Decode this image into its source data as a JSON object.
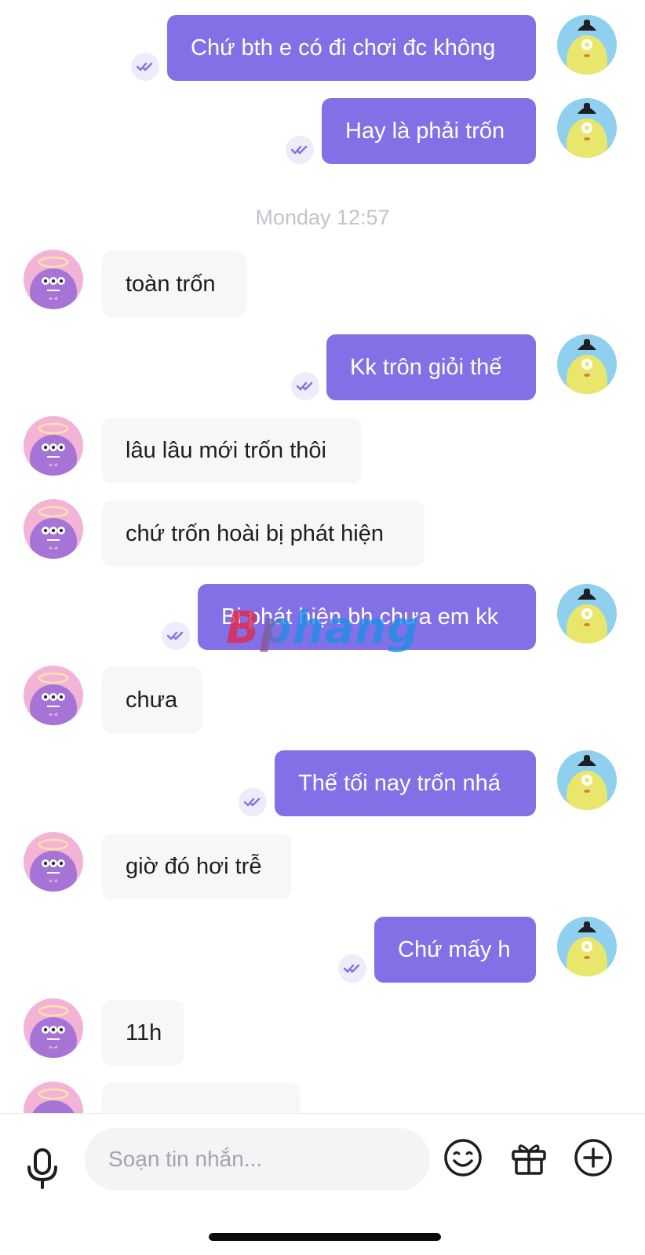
{
  "timestamp": "Monday 12:57",
  "watermark": "Bphang",
  "composer": {
    "placeholder": "Soạn tin nhắn..."
  },
  "colors": {
    "outgoing_bubble": "#8470e6",
    "incoming_bubble": "#f7f7f8",
    "read_ticks": "#8470e6"
  },
  "messages": [
    {
      "dir": "out",
      "text": "Chứ bth e có đi chơi đc không",
      "status": "read"
    },
    {
      "dir": "out",
      "text": "Hay là phải trốn",
      "status": "read"
    },
    {
      "dir": "in",
      "text": "toàn trốn"
    },
    {
      "dir": "out",
      "text": "Kk trôn giỏi thế",
      "status": "read"
    },
    {
      "dir": "in",
      "text": "lâu lâu mới trốn thôi"
    },
    {
      "dir": "in",
      "text": "chứ trốn hoài bị phát hiện"
    },
    {
      "dir": "out",
      "text": "Bị phát hiện bh chưa em kk",
      "status": "read"
    },
    {
      "dir": "in",
      "text": "chưa"
    },
    {
      "dir": "out",
      "text": "Thế tối nay trốn nhá",
      "status": "read"
    },
    {
      "dir": "in",
      "text": "giờ đó hơi trễ"
    },
    {
      "dir": "out",
      "text": "Chứ mấy h",
      "status": "read"
    },
    {
      "dir": "in",
      "text": "11h"
    }
  ],
  "toolbar": {
    "icons": [
      "microphone-icon",
      "emoji-icon",
      "gift-icon",
      "add-circle-icon"
    ]
  }
}
